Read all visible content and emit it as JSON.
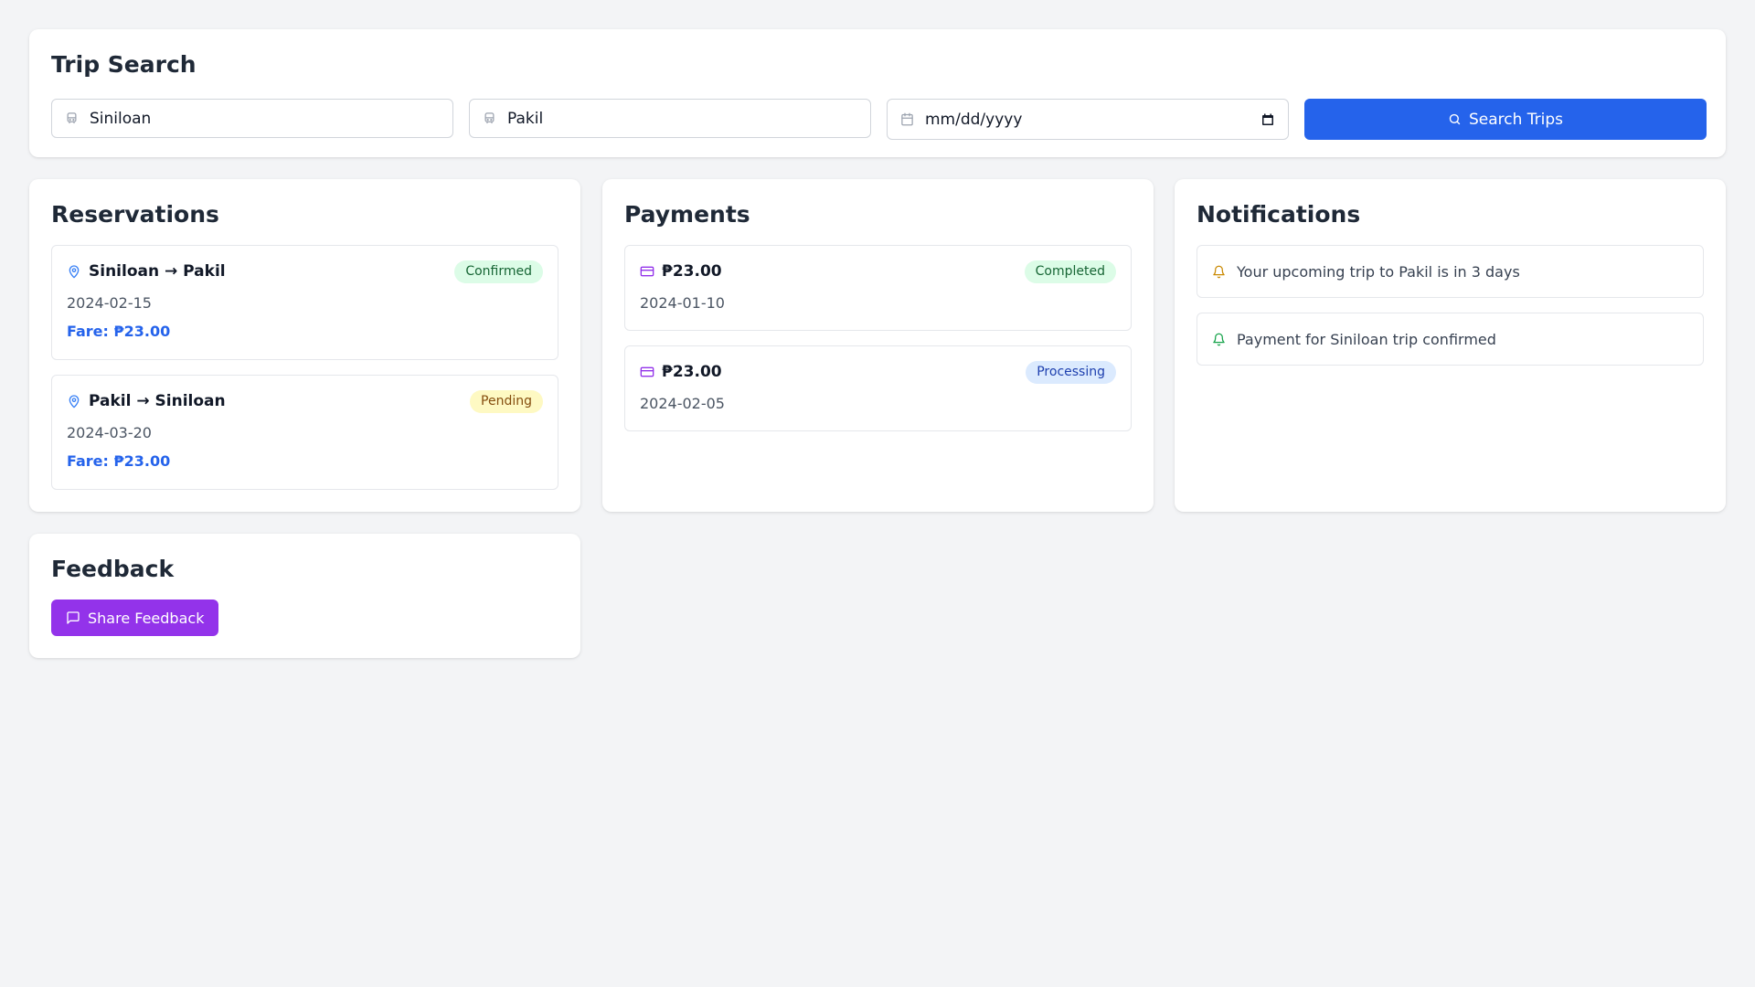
{
  "trip_search": {
    "title": "Trip Search",
    "origin_value": "Siniloan",
    "destination_value": "Pakil",
    "date_placeholder": "mm/dd/yyyy",
    "search_label": "Search Trips"
  },
  "reservations": {
    "title": "Reservations",
    "items": [
      {
        "route": "Siniloan → Pakil",
        "status": "Confirmed",
        "date": "2024-02-15",
        "fare": "Fare: ₱23.00"
      },
      {
        "route": "Pakil → Siniloan",
        "status": "Pending",
        "date": "2024-03-20",
        "fare": "Fare: ₱23.00"
      }
    ]
  },
  "payments": {
    "title": "Payments",
    "items": [
      {
        "amount": "₱23.00",
        "status": "Completed",
        "date": "2024-01-10"
      },
      {
        "amount": "₱23.00",
        "status": "Processing",
        "date": "2024-02-05"
      }
    ]
  },
  "notifications": {
    "title": "Notifications",
    "items": [
      {
        "text": "Your upcoming trip to Pakil is in 3 days",
        "icon": "bell-icon",
        "color": "#ca8a04"
      },
      {
        "text": "Payment for Siniloan trip confirmed",
        "icon": "bell-icon",
        "color": "#16a34a"
      }
    ]
  },
  "feedback": {
    "title": "Feedback",
    "button_label": "Share Feedback"
  },
  "colors": {
    "primary": "#2563eb",
    "feedback": "#9333ea",
    "location_icon": "#3b82f6",
    "payment_icon": "#9333ea"
  }
}
